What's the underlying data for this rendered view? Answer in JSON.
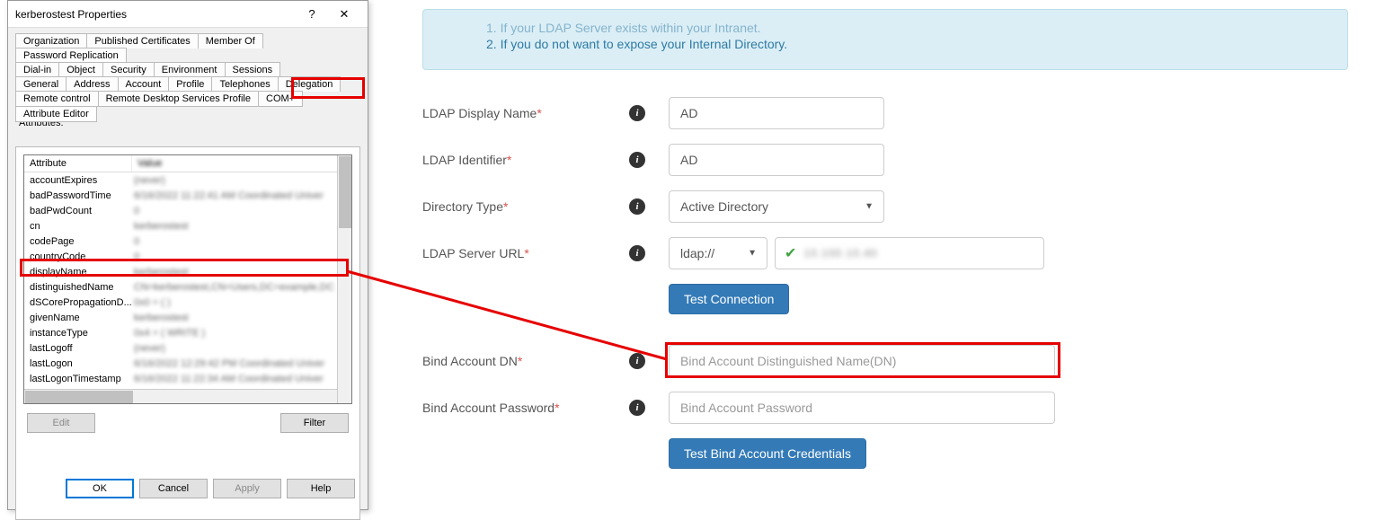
{
  "dialog": {
    "title": "kerberostest Properties",
    "help": "?",
    "close": "✕",
    "tabs_row1": [
      "Organization",
      "Published Certificates",
      "Member Of",
      "Password Replication"
    ],
    "tabs_row2": [
      "Dial-in",
      "Object",
      "Security",
      "Environment",
      "Sessions"
    ],
    "tabs_row3": [
      "General",
      "Address",
      "Account",
      "Profile",
      "Telephones",
      "Delegation"
    ],
    "tabs_row4": [
      "Remote control",
      "Remote Desktop Services Profile",
      "COM+",
      "Attribute Editor"
    ],
    "active_tab": "Attribute Editor",
    "attributes_label": "Attributes:",
    "col_attribute": "Attribute",
    "col_value": "Value",
    "rows": [
      {
        "name": "accountExpires",
        "val": "(never)"
      },
      {
        "name": "badPasswordTime",
        "val": "6/16/2022 11:22:41 AM Coordinated Univer"
      },
      {
        "name": "badPwdCount",
        "val": "0"
      },
      {
        "name": "cn",
        "val": "kerberostest"
      },
      {
        "name": "codePage",
        "val": "0"
      },
      {
        "name": "countryCode",
        "val": "0"
      },
      {
        "name": "displayName",
        "val": "kerberostest"
      },
      {
        "name": "distinguishedName",
        "val": "CN=kerberostest,CN=Users,DC=example,DC"
      },
      {
        "name": "dSCorePropagationD...",
        "val": "0x0 = ( )"
      },
      {
        "name": "givenName",
        "val": "kerberostest"
      },
      {
        "name": "instanceType",
        "val": "0x4 = ( WRITE )"
      },
      {
        "name": "lastLogoff",
        "val": "(never)"
      },
      {
        "name": "lastLogon",
        "val": "6/16/2022 12:29:42 PM Coordinated Univer"
      },
      {
        "name": "lastLogonTimestamp",
        "val": "6/16/2022 11:22:34 AM Coordinated Univer"
      }
    ],
    "edit_btn": "Edit",
    "filter_btn": "Filter",
    "ok_btn": "OK",
    "cancel_btn": "Cancel",
    "apply_btn": "Apply",
    "help_btn": "Help"
  },
  "info": {
    "line1": "If your LDAP Server exists within your Intranet.",
    "line2": "If you do not want to expose your Internal Directory."
  },
  "form": {
    "display_name_label": "LDAP Display Name",
    "display_name_value": "AD",
    "identifier_label": "LDAP Identifier",
    "identifier_value": "AD",
    "dir_type_label": "Directory Type",
    "dir_type_value": "Active Directory",
    "url_label": "LDAP Server URL",
    "url_scheme": "ldap://",
    "test_conn_btn": "Test Connection",
    "bind_dn_label": "Bind Account DN",
    "bind_dn_placeholder": "Bind Account Distinguished Name(DN)",
    "bind_pw_label": "Bind Account Password",
    "bind_pw_placeholder": "Bind Account Password",
    "test_bind_btn": "Test Bind Account Credentials"
  }
}
